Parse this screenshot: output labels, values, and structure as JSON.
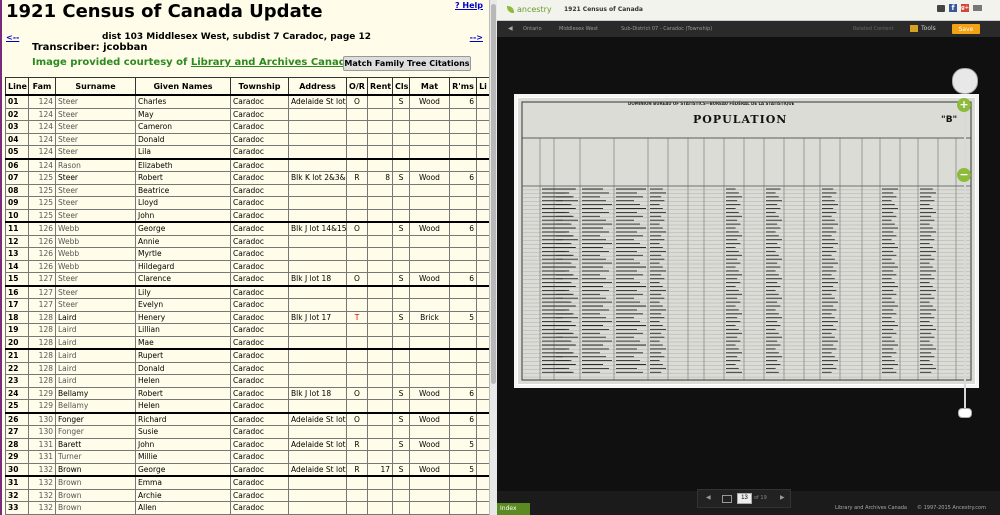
{
  "left": {
    "title": "1921 Census of Canada Update",
    "help": "? Help",
    "prev": "<--",
    "next": "-->",
    "district": "dist 103 Middlesex West, subdist 7 Caradoc, page 12",
    "transcriber": "Transcriber: jcobban",
    "courtesy_prefix": "Image provided courtesy of ",
    "courtesy_link": "Library and Archives Canada",
    "courtesy_suffix": ".",
    "match_button": "Match Family Tree Citations",
    "columns": [
      "Line",
      "Fam",
      "Surname",
      "Given Names",
      "Township",
      "Address",
      "O/R",
      "Rent",
      "Cls",
      "Mat",
      "R'ms",
      "Li"
    ],
    "rows": [
      {
        "line": "01",
        "fam": "124",
        "surname": "Steer",
        "given": "Charles",
        "township": "Caradoc",
        "address": "Adelaide St lot",
        "or": "O",
        "rent": "",
        "cls": "S",
        "mat": "Wood",
        "rms": "6",
        "grp": true
      },
      {
        "line": "02",
        "fam": "124",
        "surname": "Steer",
        "given": "May",
        "township": "Caradoc",
        "address": "",
        "or": "",
        "rent": "",
        "cls": "",
        "mat": "",
        "rms": ""
      },
      {
        "line": "03",
        "fam": "124",
        "surname": "Steer",
        "given": "Cameron",
        "township": "Caradoc",
        "address": "",
        "or": "",
        "rent": "",
        "cls": "",
        "mat": "",
        "rms": ""
      },
      {
        "line": "04",
        "fam": "124",
        "surname": "Steer",
        "given": "Donald",
        "township": "Caradoc",
        "address": "",
        "or": "",
        "rent": "",
        "cls": "",
        "mat": "",
        "rms": ""
      },
      {
        "line": "05",
        "fam": "124",
        "surname": "Steer",
        "given": "Lila",
        "township": "Caradoc",
        "address": "",
        "or": "",
        "rent": "",
        "cls": "",
        "mat": "",
        "rms": ""
      },
      {
        "line": "06",
        "fam": "124",
        "surname": "Rason",
        "given": "Elizabeth",
        "township": "Caradoc",
        "address": "",
        "or": "",
        "rent": "",
        "cls": "",
        "mat": "",
        "rms": "",
        "grp": true
      },
      {
        "line": "07",
        "fam": "125",
        "surname": "Steer",
        "given": "Robert",
        "township": "Caradoc",
        "address": "Blk K lot 2&3&4",
        "or": "R",
        "rent": "8",
        "cls": "S",
        "mat": "Wood",
        "rms": "6",
        "dark": true
      },
      {
        "line": "08",
        "fam": "125",
        "surname": "Steer",
        "given": "Beatrice",
        "township": "Caradoc",
        "address": "",
        "or": "",
        "rent": "",
        "cls": "",
        "mat": "",
        "rms": ""
      },
      {
        "line": "09",
        "fam": "125",
        "surname": "Steer",
        "given": "Lloyd",
        "township": "Caradoc",
        "address": "",
        "or": "",
        "rent": "",
        "cls": "",
        "mat": "",
        "rms": ""
      },
      {
        "line": "10",
        "fam": "125",
        "surname": "Steer",
        "given": "John",
        "township": "Caradoc",
        "address": "",
        "or": "",
        "rent": "",
        "cls": "",
        "mat": "",
        "rms": ""
      },
      {
        "line": "11",
        "fam": "126",
        "surname": "Webb",
        "given": "George",
        "township": "Caradoc",
        "address": "Blk J lot 14&15",
        "or": "O",
        "rent": "",
        "cls": "S",
        "mat": "Wood",
        "rms": "6",
        "grp": true
      },
      {
        "line": "12",
        "fam": "126",
        "surname": "Webb",
        "given": "Annie",
        "township": "Caradoc",
        "address": "",
        "or": "",
        "rent": "",
        "cls": "",
        "mat": "",
        "rms": ""
      },
      {
        "line": "13",
        "fam": "126",
        "surname": "Webb",
        "given": "Myrtle",
        "township": "Caradoc",
        "address": "",
        "or": "",
        "rent": "",
        "cls": "",
        "mat": "",
        "rms": ""
      },
      {
        "line": "14",
        "fam": "126",
        "surname": "Webb",
        "given": "Hildegard",
        "township": "Caradoc",
        "address": "",
        "or": "",
        "rent": "",
        "cls": "",
        "mat": "",
        "rms": ""
      },
      {
        "line": "15",
        "fam": "127",
        "surname": "Steer",
        "given": "Clarence",
        "township": "Caradoc",
        "address": "Blk J lot 18",
        "or": "O",
        "rent": "",
        "cls": "S",
        "mat": "Wood",
        "rms": "6"
      },
      {
        "line": "16",
        "fam": "127",
        "surname": "Steer",
        "given": "Lily",
        "township": "Caradoc",
        "address": "",
        "or": "",
        "rent": "",
        "cls": "",
        "mat": "",
        "rms": "",
        "grp": true
      },
      {
        "line": "17",
        "fam": "127",
        "surname": "Steer",
        "given": "Evelyn",
        "township": "Caradoc",
        "address": "",
        "or": "",
        "rent": "",
        "cls": "",
        "mat": "",
        "rms": ""
      },
      {
        "line": "18",
        "fam": "128",
        "surname": "Laird",
        "given": "Henery",
        "township": "Caradoc",
        "address": "Blk J lot 17",
        "or": "T",
        "rent": "",
        "cls": "S",
        "mat": "Brick",
        "rms": "5",
        "dark": true,
        "or_red": true
      },
      {
        "line": "19",
        "fam": "128",
        "surname": "Laird",
        "given": "Lillian",
        "township": "Caradoc",
        "address": "",
        "or": "",
        "rent": "",
        "cls": "",
        "mat": "",
        "rms": ""
      },
      {
        "line": "20",
        "fam": "128",
        "surname": "Laird",
        "given": "Mae",
        "township": "Caradoc",
        "address": "",
        "or": "",
        "rent": "",
        "cls": "",
        "mat": "",
        "rms": ""
      },
      {
        "line": "21",
        "fam": "128",
        "surname": "Laird",
        "given": "Rupert",
        "township": "Caradoc",
        "address": "",
        "or": "",
        "rent": "",
        "cls": "",
        "mat": "",
        "rms": "",
        "grp": true
      },
      {
        "line": "22",
        "fam": "128",
        "surname": "Laird",
        "given": "Donald",
        "township": "Caradoc",
        "address": "",
        "or": "",
        "rent": "",
        "cls": "",
        "mat": "",
        "rms": ""
      },
      {
        "line": "23",
        "fam": "128",
        "surname": "Laird",
        "given": "Helen",
        "township": "Caradoc",
        "address": "",
        "or": "",
        "rent": "",
        "cls": "",
        "mat": "",
        "rms": ""
      },
      {
        "line": "24",
        "fam": "129",
        "surname": "Bellamy",
        "given": "Robert",
        "township": "Caradoc",
        "address": "Blk J lot 18",
        "or": "O",
        "rent": "",
        "cls": "S",
        "mat": "Wood",
        "rms": "6",
        "dark": true
      },
      {
        "line": "25",
        "fam": "129",
        "surname": "Bellamy",
        "given": "Helen",
        "township": "Caradoc",
        "address": "",
        "or": "",
        "rent": "",
        "cls": "",
        "mat": "",
        "rms": ""
      },
      {
        "line": "26",
        "fam": "130",
        "surname": "Fonger",
        "given": "Richard",
        "township": "Caradoc",
        "address": "Adelaide St lot",
        "or": "O",
        "rent": "",
        "cls": "S",
        "mat": "Wood",
        "rms": "6",
        "grp": true,
        "dark": true
      },
      {
        "line": "27",
        "fam": "130",
        "surname": "Fonger",
        "given": "Susie",
        "township": "Caradoc",
        "address": "",
        "or": "",
        "rent": "",
        "cls": "",
        "mat": "",
        "rms": ""
      },
      {
        "line": "28",
        "fam": "131",
        "surname": "Barett",
        "given": "John",
        "township": "Caradoc",
        "address": "Adelaide St lot",
        "or": "R",
        "rent": "",
        "cls": "S",
        "mat": "Wood",
        "rms": "5",
        "dark": true
      },
      {
        "line": "29",
        "fam": "131",
        "surname": "Turner",
        "given": "Millie",
        "township": "Caradoc",
        "address": "",
        "or": "",
        "rent": "",
        "cls": "",
        "mat": "",
        "rms": ""
      },
      {
        "line": "30",
        "fam": "132",
        "surname": "Brown",
        "given": "George",
        "township": "Caradoc",
        "address": "Adelaide St lot",
        "or": "R",
        "rent": "17",
        "cls": "S",
        "mat": "Wood",
        "rms": "5",
        "dark": true
      },
      {
        "line": "31",
        "fam": "132",
        "surname": "Brown",
        "given": "Emma",
        "township": "Caradoc",
        "address": "",
        "or": "",
        "rent": "",
        "cls": "",
        "mat": "",
        "rms": "",
        "grp": true
      },
      {
        "line": "32",
        "fam": "132",
        "surname": "Brown",
        "given": "Archie",
        "township": "Caradoc",
        "address": "",
        "or": "",
        "rent": "",
        "cls": "",
        "mat": "",
        "rms": ""
      },
      {
        "line": "33",
        "fam": "132",
        "surname": "Brown",
        "given": "Allen",
        "township": "Caradoc",
        "address": "",
        "or": "",
        "rent": "",
        "cls": "",
        "mat": "",
        "rms": ""
      }
    ]
  },
  "right": {
    "logo": "ancestry",
    "collection": "1921 Census of Canada",
    "breadcrumbs": [
      "Ontario",
      "Middlesex West",
      "Sub-District 07 - Caradoc (Township)"
    ],
    "related": "Related Content",
    "tools": "Tools",
    "save": "Save",
    "doc_header": "DOMINION BUREAU OF STATISTICS—BUREAU FÉDÉRAL DE LA STATISTIQUE",
    "doc_title": "POPULATION",
    "doc_b": "\"B\"",
    "page_current": "13",
    "page_of": "of 19",
    "index": "Index",
    "source": "Library and Archives Canada",
    "copyright": "© 1997-2015 Ancestry.com"
  },
  "colors": {
    "green_link": "#2b8a1e",
    "ancestry_green": "#8dbb3c",
    "save_orange": "#f3a213",
    "pane_bg": "#fffde9"
  },
  "icons": [
    "print-icon",
    "facebook-icon",
    "google-plus-icon",
    "mail-icon",
    "tools-icon",
    "pan-icon",
    "zoom-in-icon",
    "zoom-out-icon",
    "thumbnail-icon"
  ]
}
